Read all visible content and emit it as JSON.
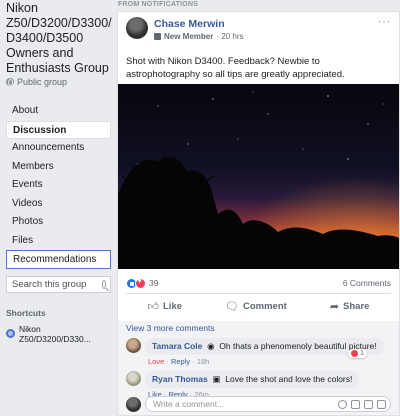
{
  "sidebar": {
    "group_title": "Nikon Z50/D3200/D3300/ D3400/D3500 Owners and Enthusiasts Group",
    "group_type": "Public group",
    "nav": [
      {
        "label": "About"
      },
      {
        "label": "Discussion"
      },
      {
        "label": "Announcements"
      },
      {
        "label": "Members"
      },
      {
        "label": "Events"
      },
      {
        "label": "Videos"
      },
      {
        "label": "Photos"
      },
      {
        "label": "Files"
      },
      {
        "label": "Recommendations"
      }
    ],
    "search_placeholder": "Search this group",
    "shortcuts_heading": "Shortcuts",
    "shortcut_item": "Nikon Z50/D3200/D330..."
  },
  "feed": {
    "section_label": "FROM NOTIFICATIONS",
    "post": {
      "author": "Chase Merwin",
      "badge": "New Member",
      "time": "20 hrs",
      "text": "Shot with Nikon D3400. Feedback? Newbie to astrophotography so all tips are greatly appreciated.",
      "reaction_count": "39",
      "comments_count": "6 Comments",
      "actions": {
        "like": "Like",
        "comment": "Comment",
        "share": "Share"
      }
    },
    "comments": {
      "view_more": "View 3 more comments",
      "items": [
        {
          "name": "Tamara Cole",
          "text": "Oh thats a phenomenoly beautiful picture!",
          "reaction": "Love",
          "reply": "Reply",
          "time": "18h",
          "react_count": "1"
        },
        {
          "name": "Ryan Thomas",
          "text": "Love the shot and love the colors!",
          "like": "Like",
          "reply": "Reply",
          "time": "26m"
        }
      ],
      "write_placeholder": "Write a comment..."
    }
  },
  "colors": {
    "link_blue": "#385898",
    "background": "#e9ebee",
    "love_red": "#f33e58",
    "like_blue": "#1877f2"
  }
}
